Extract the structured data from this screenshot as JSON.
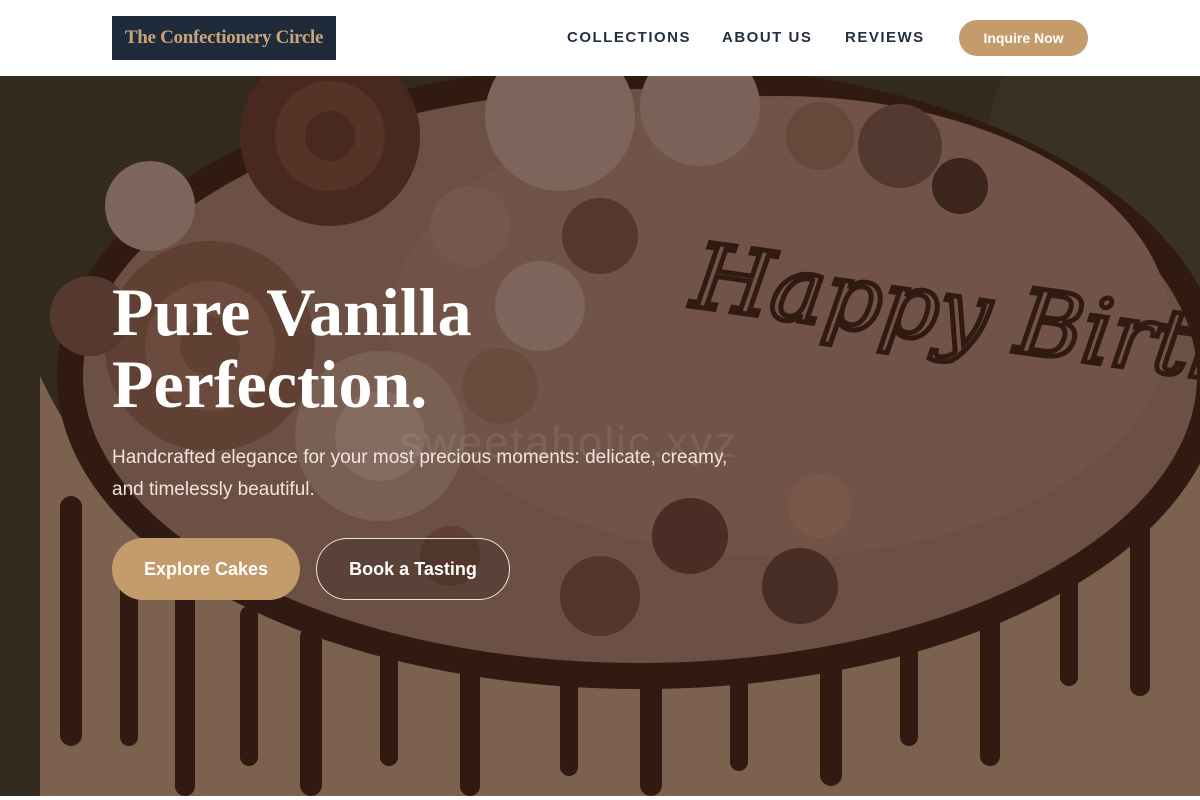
{
  "header": {
    "logo_text": "The Confectionery Circle",
    "nav": [
      {
        "label": "COLLECTIONS"
      },
      {
        "label": "ABOUT US"
      },
      {
        "label": "REVIEWS"
      }
    ],
    "cta_label": "Inquire Now"
  },
  "hero": {
    "title_line1": "Pure Vanilla",
    "title_line2": "Perfection.",
    "subtitle": "Handcrafted elegance for your most precious moments: delicate, creamy, and timelessly beautiful.",
    "primary_button": "Explore Cakes",
    "secondary_button": "Book a Tasting",
    "image_text": "Happy Birthday",
    "watermark": "sweetaholic.xyz"
  },
  "colors": {
    "accent": "#c49b6a",
    "logo_bg": "#1f2a3a",
    "nav_text": "#243041"
  }
}
